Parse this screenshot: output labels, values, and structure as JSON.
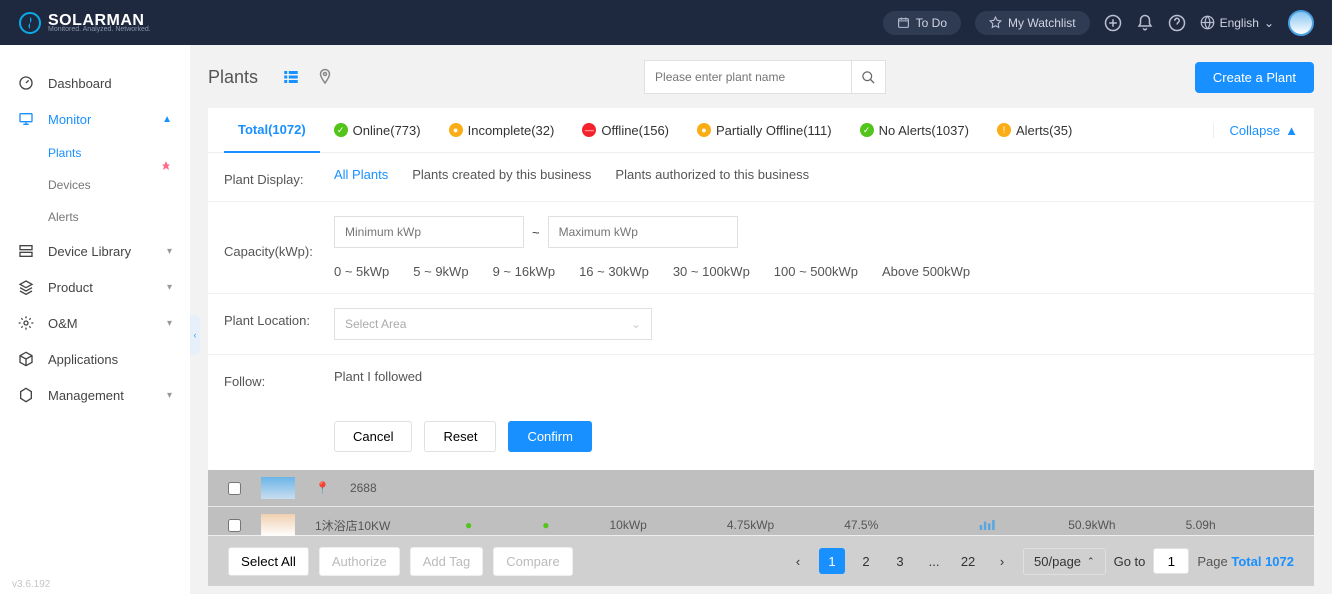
{
  "header": {
    "brand": "SOLARMAN",
    "tagline": "Monitored. Analyzed. Networked.",
    "todo": "To Do",
    "watchlist": "My Watchlist",
    "language": "English"
  },
  "sidebar": {
    "dashboard": "Dashboard",
    "monitor": "Monitor",
    "plants": "Plants",
    "devices": "Devices",
    "alerts": "Alerts",
    "device_library": "Device Library",
    "product": "Product",
    "om": "O&M",
    "applications": "Applications",
    "management": "Management"
  },
  "main": {
    "title": "Plants",
    "search_placeholder": "Please enter plant name",
    "create": "Create a Plant"
  },
  "tabs": {
    "total": "Total(1072)",
    "online": "Online(773)",
    "incomplete": "Incomplete(32)",
    "offline": "Offline(156)",
    "partial": "Partially Offline(111)",
    "noalerts": "No Alerts(1037)",
    "alerts": "Alerts(35)",
    "collapse": "Collapse"
  },
  "filters": {
    "display_label": "Plant Display:",
    "display": {
      "all": "All Plants",
      "created": "Plants created by this business",
      "authorized": "Plants authorized to this business"
    },
    "capacity_label": "Capacity(kWp):",
    "min_ph": "Minimum kWp",
    "max_ph": "Maximum kWp",
    "tilde": "~",
    "ranges": {
      "r1": "0 ~ 5kWp",
      "r2": "5 ~ 9kWp",
      "r3": "9 ~ 16kWp",
      "r4": "16 ~ 30kWp",
      "r5": "30 ~ 100kWp",
      "r6": "100 ~ 500kWp",
      "r7": "Above 500kWp"
    },
    "location_label": "Plant Location:",
    "location_ph": "Select Area",
    "follow_label": "Follow:",
    "follow_value": "Plant I followed",
    "cancel": "Cancel",
    "reset": "Reset",
    "confirm": "Confirm"
  },
  "list": {
    "row1": {
      "id": "2688"
    },
    "row2": {
      "name": "1沐浴店10KW",
      "c1": "10kWp",
      "c2": "4.75kWp",
      "c3": "47.5%",
      "c4": "50.9kWh",
      "c5": "5.09h"
    }
  },
  "pager": {
    "select_all": "Select All",
    "authorize": "Authorize",
    "add_tag": "Add Tag",
    "compare": "Compare",
    "p1": "1",
    "p2": "2",
    "p3": "3",
    "dots": "...",
    "last": "22",
    "page_size": "50/page",
    "goto": "Go to",
    "goto_val": "1",
    "total_label": "Page ",
    "total_count": "Total 1072"
  },
  "version": "v3.6.192"
}
